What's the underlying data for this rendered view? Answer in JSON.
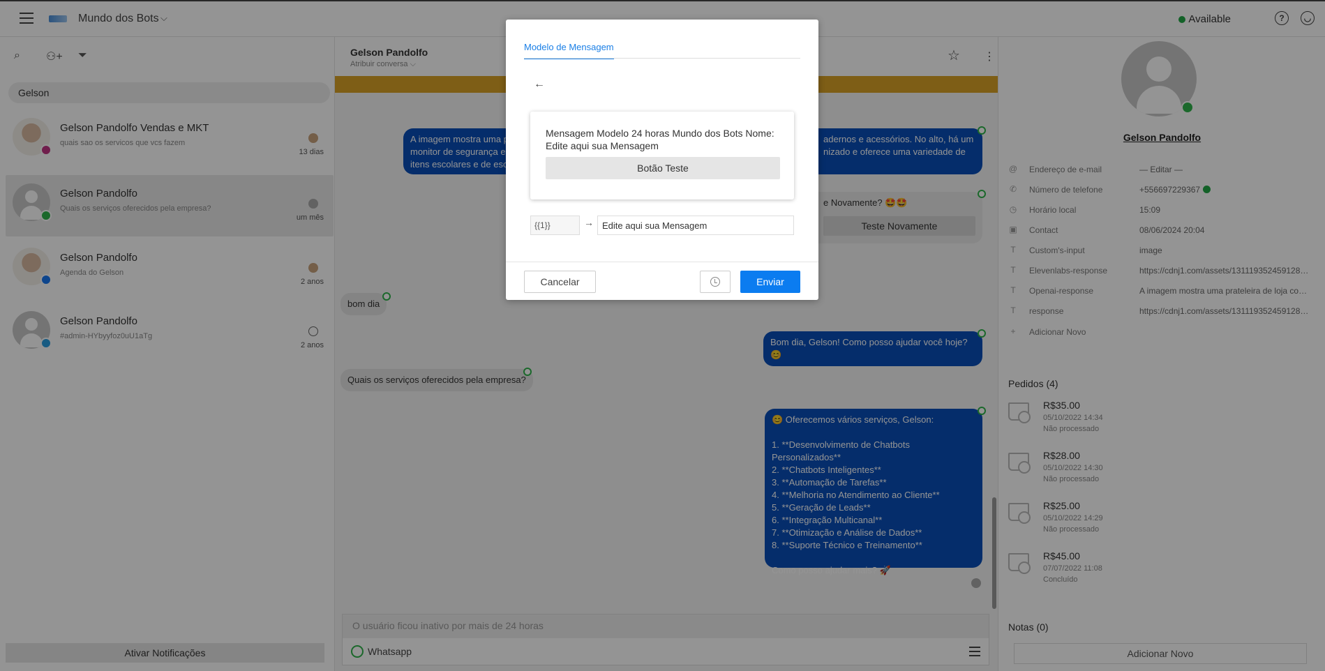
{
  "topbar": {
    "workspace": "Mundo dos Bots",
    "status": "Available",
    "status_color": "#22a845",
    "icons": [
      "menu-icon",
      "chevron-down-icon",
      "help-icon",
      "user-icon"
    ]
  },
  "left": {
    "search_value": "Gelson",
    "conversations": [
      {
        "name": "Gelson Pandolfo Vendas e MKT",
        "preview": "quais sao os servicos que vcs fazem",
        "time": "13 dias",
        "channel": "instagram"
      },
      {
        "name": "Gelson Pandolfo",
        "preview": "Quais os serviços oferecidos pela empresa?",
        "time": "um mês",
        "channel": "whatsapp"
      },
      {
        "name": "Gelson Pandolfo",
        "preview": "Agenda do Gelson",
        "time": "2 anos",
        "channel": "messenger"
      },
      {
        "name": "Gelson Pandolfo",
        "preview": "#admin-HYbyyfoz0uU1aTg",
        "time": "2 anos",
        "channel": "telegram"
      }
    ],
    "notifications_button": "Ativar Notificações"
  },
  "chat": {
    "contact_name": "Gelson Pandolfo",
    "assign_label": "Atribuir conversa",
    "messages": {
      "img_desc_left": "A imagem mostra uma p",
      "img_desc_left2": "monitor de segurança e",
      "img_desc_left3": "itens escolares e de esc",
      "img_desc_right": "adernos e acessórios. No alto, há um",
      "img_desc_right2": "nizado e oferece uma variedade de",
      "teste_caption": "e Novamente? 🤩🤩",
      "teste_button": "Teste Novamente",
      "bom_dia": "bom dia",
      "reply_greeting": "Bom dia, Gelson! Como posso ajudar você hoje? 😊",
      "question": "Quais os serviços oferecidos pela empresa?",
      "services_intro": "😊 Oferecemos vários serviços, Gelson:",
      "services": [
        "1. **Desenvolvimento de Chatbots Personalizados**",
        "2. **Chatbots Inteligentes**",
        "3. **Automação de Tarefas**",
        "4. **Melhoria no Atendimento ao Cliente**",
        "5. **Geração de Leads**",
        "6. **Integração Multicanal**",
        "7. **Otimização e Análise de Dados**",
        "8. **Suporte Técnico e Treinamento**"
      ],
      "services_outro": "Como posso ajudar mais? 🚀"
    },
    "composer_placeholder": "O usuário ficou inativo por mais de 24 horas",
    "channel_label": "Whatsapp"
  },
  "right": {
    "name": "Gelson Pandolfo",
    "props": [
      {
        "icon": "at-icon",
        "key": "Endereço de e-mail",
        "value": "— Editar —"
      },
      {
        "icon": "phone-icon",
        "key": "Número de telefone",
        "value": "+556697229367"
      },
      {
        "icon": "clock-icon",
        "key": "Horário local",
        "value": "15:09"
      },
      {
        "icon": "contact-icon",
        "key": "Contact",
        "value": "08/06/2024 20:04"
      },
      {
        "icon": "text-icon",
        "key": "Custom's-input",
        "value": "image"
      },
      {
        "icon": "text-icon",
        "key": "Elevenlabs-response",
        "value": "https://cdnj1.com/assets/131119352459128…"
      },
      {
        "icon": "text-icon",
        "key": "Openai-response",
        "value": "A imagem mostra uma prateleira de loja com …"
      },
      {
        "icon": "text-icon",
        "key": "response",
        "value": "https://cdnj1.com/assets/131119352459128…"
      }
    ],
    "add_new": "Adicionar Novo",
    "orders_title": "Pedidos (4)",
    "orders": [
      {
        "price": "R$35.00",
        "date": "05/10/2022 14:34",
        "status": "Não processado"
      },
      {
        "price": "R$28.00",
        "date": "05/10/2022 14:30",
        "status": "Não processado"
      },
      {
        "price": "R$25.00",
        "date": "05/10/2022 14:29",
        "status": "Não processado"
      },
      {
        "price": "R$45.00",
        "date": "07/07/2022 11:08",
        "status": "Concluído"
      }
    ],
    "notes_title": "Notas (0)",
    "add_note": "Adicionar Novo"
  },
  "modal": {
    "tab": "Modelo de Mensagem",
    "card_text": "Mensagem Modelo 24 horas Mundo dos Bots Nome: Edite aqui sua Mensagem",
    "card_button": "Botão Teste",
    "variable": "{{1}}",
    "variable_value": "Edite aqui sua Mensagem",
    "cancel": "Cancelar",
    "send": "Enviar",
    "accent": "#0b7cf0"
  }
}
